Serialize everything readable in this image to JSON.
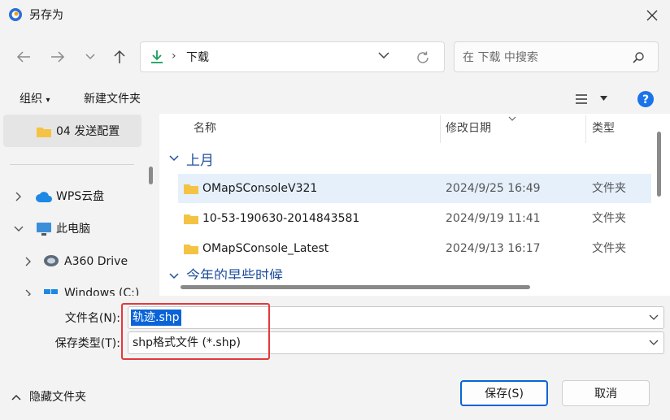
{
  "window": {
    "title": "另存为"
  },
  "nav": {
    "address": "下载",
    "address_sep": "›",
    "search_placeholder": "在 下载 中搜索"
  },
  "toolbar": {
    "organize": "组织",
    "new_folder": "新建文件夹"
  },
  "navpane": {
    "items": [
      {
        "label": "04 发送配置"
      },
      {
        "label": "WPS云盘"
      },
      {
        "label": "此电脑"
      },
      {
        "label": "A360 Drive"
      },
      {
        "label": "Windows (C:)"
      }
    ]
  },
  "columns": {
    "name": "名称",
    "modified": "修改日期",
    "type": "类型"
  },
  "groups": [
    {
      "label": "上月"
    },
    {
      "label": "今年的早些时候"
    }
  ],
  "files": [
    {
      "name": "OMapSConsoleV321",
      "modified": "2024/9/25 16:49",
      "type": "文件夹"
    },
    {
      "name": "10-53-190630-2014843581",
      "modified": "2024/9/19 11:41",
      "type": "文件夹"
    },
    {
      "name": "OMapSConsole_Latest",
      "modified": "2024/9/13 16:17",
      "type": "文件夹"
    }
  ],
  "form": {
    "filename_label": "文件名(N):",
    "filename_value": "轨迹.shp",
    "filetype_label": "保存类型(T):",
    "filetype_value": "shp格式文件 (*.shp)"
  },
  "footer": {
    "hide_folders": "隐藏文件夹",
    "save": "保存(S)",
    "cancel": "取消"
  },
  "colors": {
    "accent": "#0a64d8",
    "highlight_box": "#e5383b",
    "folder": "#f5c344",
    "group_text": "#1f4e9c"
  }
}
